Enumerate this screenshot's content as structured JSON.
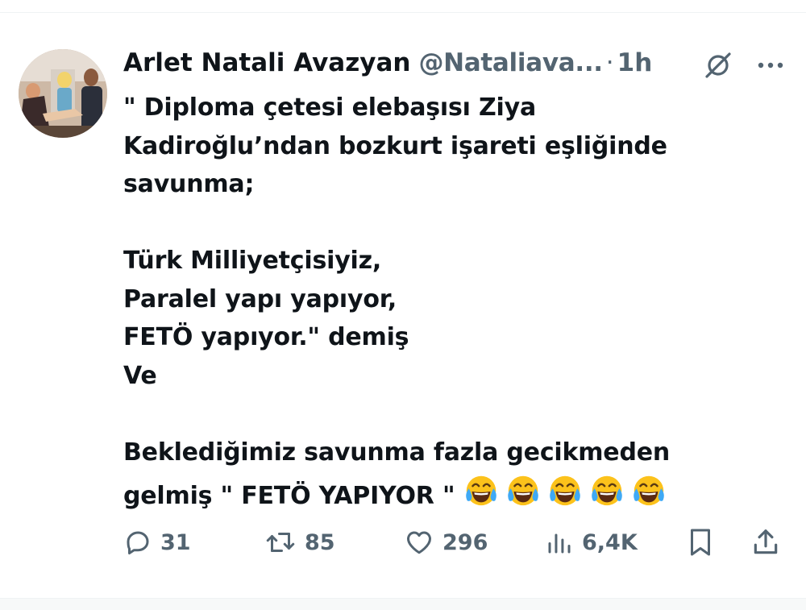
{
  "tweet": {
    "author": {
      "display_name": "Arlet Natali Avazyan",
      "handle": "@Nataliava...",
      "separator": "·",
      "time": "1h",
      "avatar_icon": "profile-photo"
    },
    "header_icons": [
      "grok-icon",
      "more-icon"
    ],
    "text_lines": [
      "\" Diploma çetesi elebaşısı Ziya",
      "Kadiroğlu’ndan bozkurt işareti eşliğinde",
      "savunma;",
      "",
      "Türk Milliyetçisiyiz,",
      "Paralel yapı yapıyor,",
      "FETÖ yapıyor.\" demiş",
      "Ve",
      "",
      "Beklediğimiz savunma fazla gecikmeden",
      "gelmiş \" FETÖ YAPIYOR \""
    ],
    "emojis": [
      "face-with-tears-of-joy",
      "face-with-tears-of-joy",
      "face-with-tears-of-joy",
      "face-with-tears-of-joy",
      "face-with-tears-of-joy"
    ],
    "actions": {
      "replies": "31",
      "reposts": "85",
      "likes": "296",
      "views": "6,4K"
    }
  },
  "colors": {
    "text": "#0f1419",
    "secondary": "#536471",
    "divider": "#eff3f4",
    "emoji_face": "#fcc21b",
    "emoji_tear": "#3fa9f5"
  }
}
